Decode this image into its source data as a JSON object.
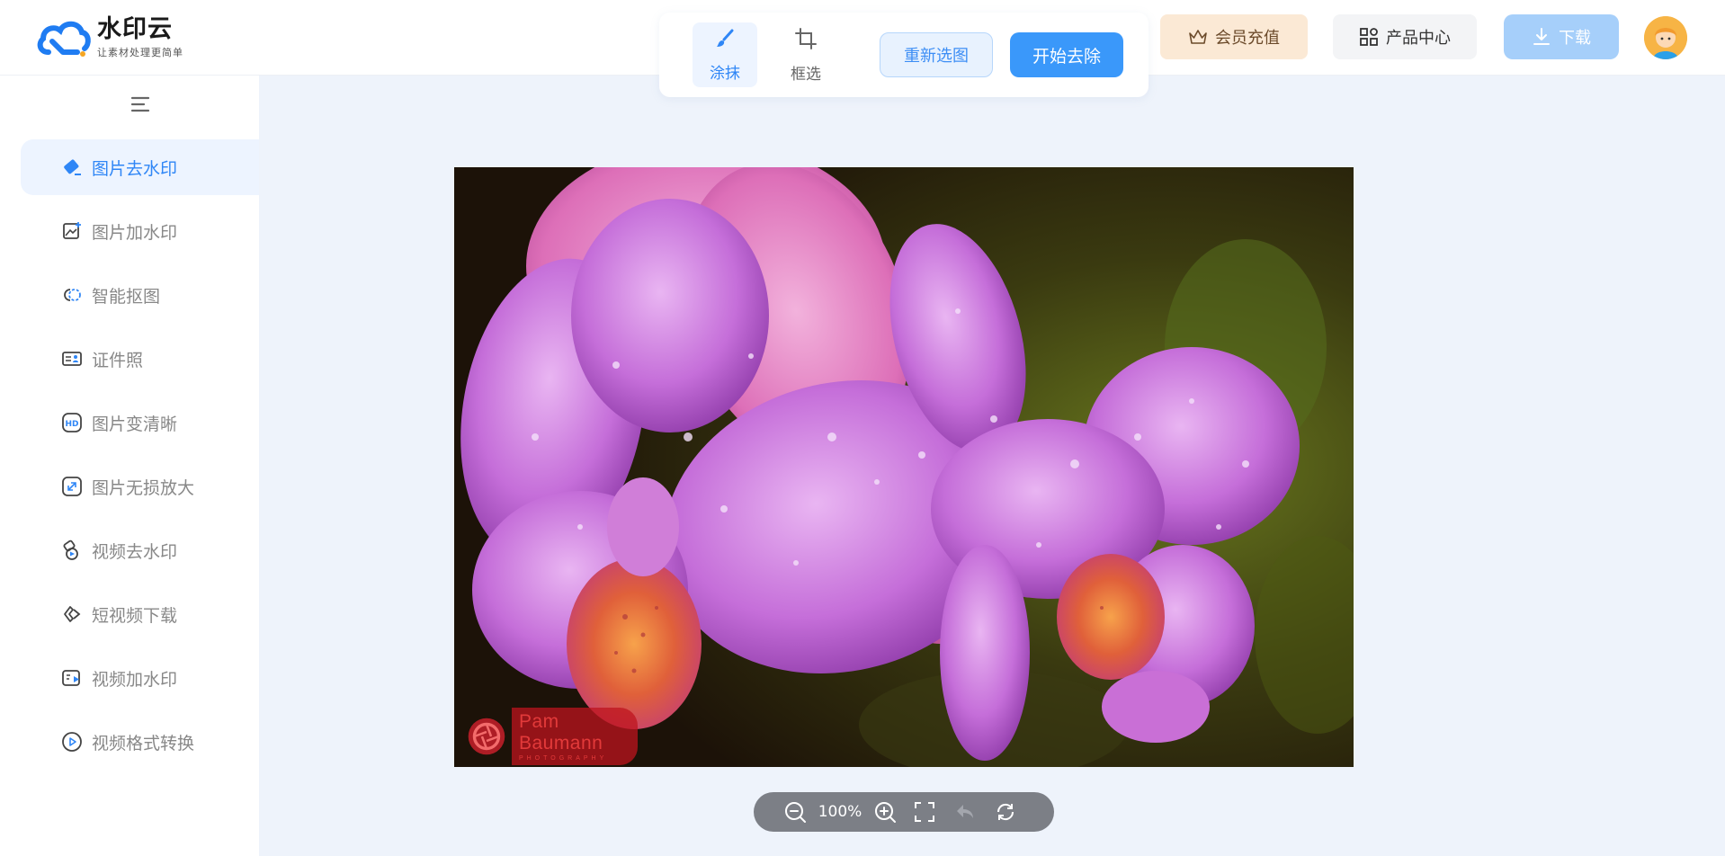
{
  "app": {
    "name": "水印云",
    "slogan": "让素材处理更简单"
  },
  "toolbar": {
    "tools": [
      {
        "label": "涂抹",
        "icon": "brush-icon",
        "active": true
      },
      {
        "label": "框选",
        "icon": "crop-icon",
        "active": false
      }
    ],
    "reselect_label": "重新选图",
    "start_label": "开始去除"
  },
  "header": {
    "vip_label": "会员充值",
    "products_label": "产品中心",
    "download_label": "下载"
  },
  "sidebar": {
    "items": [
      {
        "label": "图片去水印",
        "icon": "eraser-icon",
        "active": true
      },
      {
        "label": "图片加水印",
        "icon": "image-add-icon",
        "active": false
      },
      {
        "label": "智能抠图",
        "icon": "cutout-icon",
        "active": false
      },
      {
        "label": "证件照",
        "icon": "id-card-icon",
        "active": false
      },
      {
        "label": "图片变清晰",
        "icon": "hd-icon",
        "active": false
      },
      {
        "label": "图片无损放大",
        "icon": "enlarge-icon",
        "active": false
      },
      {
        "label": "视频去水印",
        "icon": "video-eraser-icon",
        "active": false
      },
      {
        "label": "短视频下载",
        "icon": "link-icon",
        "active": false
      },
      {
        "label": "视频加水印",
        "icon": "video-add-icon",
        "active": false
      },
      {
        "label": "视频格式转换",
        "icon": "play-circle-icon",
        "active": false
      }
    ]
  },
  "canvas": {
    "watermark_main": "Pam Baumann",
    "watermark_sub": "PHOTOGRAPHY"
  },
  "zoom": {
    "value": "100%"
  },
  "colors": {
    "accent": "#3a98fa",
    "active_bg": "#edf4ff",
    "page_bg": "#eef3fb"
  }
}
